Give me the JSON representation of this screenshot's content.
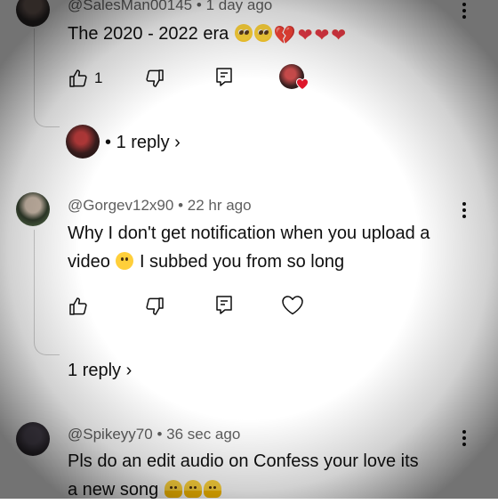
{
  "comments": [
    {
      "handle": "@SalesMan00145",
      "time": "1 day ago",
      "text": "The 2020 - 2022 era",
      "emoji_icons": [
        "pleading-face-icon",
        "pleading-face-icon",
        "broken-heart-icon",
        "heart-on-fire-icon",
        "heart-on-fire-icon",
        "heart-on-fire-icon"
      ],
      "likes": "1",
      "replies_label": "1 reply",
      "replies_separator": "•",
      "creator_liked": true
    },
    {
      "handle": "@Gorgev12x90",
      "time": "22 hr ago",
      "text_line1": "Why I don't get notification when you upload a",
      "text_line2_a": "video",
      "text_line2_b": "I subbed you from so long",
      "emoji_icons": [
        "worried-face-icon"
      ],
      "likes": "",
      "replies_label": "1 reply"
    },
    {
      "handle": "@Spikeyy70",
      "time": "36 sec ago",
      "text_line1": "Pls do an edit audio on Confess your love its",
      "text_line2": "a new song",
      "emoji_icons": [
        "melting-face-icon",
        "melting-face-icon",
        "melting-face-icon"
      ]
    }
  ],
  "meta_separator": "•",
  "colors": {
    "text": "#0f0f0f",
    "meta": "#606060",
    "thread_line": "#cfcfcf",
    "heart_badge": "#e0162b"
  }
}
